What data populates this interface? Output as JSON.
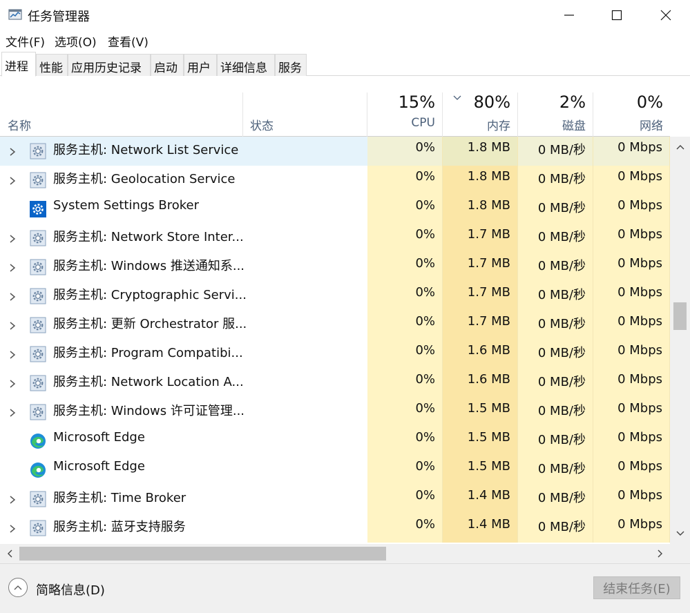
{
  "window": {
    "title": "任务管理器",
    "icon": "task-manager-icon"
  },
  "menu": [
    "文件(F)",
    "选项(O)",
    "查看(V)"
  ],
  "tabs": [
    "进程",
    "性能",
    "应用历史记录",
    "启动",
    "用户",
    "详细信息",
    "服务"
  ],
  "active_tab": "进程",
  "columns": {
    "name": "名称",
    "status": "状态",
    "cpu": {
      "percent": "15%",
      "label": "CPU"
    },
    "memory": {
      "percent": "80%",
      "label": "内存"
    },
    "disk": {
      "percent": "2%",
      "label": "磁盘"
    },
    "network": {
      "percent": "0%",
      "label": "网络"
    }
  },
  "processes": [
    {
      "name": "服务主机: Network List Service",
      "icon": "gear-icon",
      "expandable": true,
      "selected": true,
      "cpu": "0%",
      "mem": "1.8 MB",
      "disk": "0 MB/秒",
      "net": "0 Mbps"
    },
    {
      "name": "服务主机: Geolocation Service",
      "icon": "gear-icon",
      "expandable": true,
      "cpu": "0%",
      "mem": "1.8 MB",
      "disk": "0 MB/秒",
      "net": "0 Mbps"
    },
    {
      "name": "System Settings Broker",
      "icon": "settings-blue-icon",
      "expandable": false,
      "cpu": "0%",
      "mem": "1.8 MB",
      "disk": "0 MB/秒",
      "net": "0 Mbps"
    },
    {
      "name": "服务主机: Network Store Inter...",
      "icon": "gear-icon",
      "expandable": true,
      "cpu": "0%",
      "mem": "1.7 MB",
      "disk": "0 MB/秒",
      "net": "0 Mbps"
    },
    {
      "name": "服务主机: Windows 推送通知系...",
      "icon": "gear-icon",
      "expandable": true,
      "cpu": "0%",
      "mem": "1.7 MB",
      "disk": "0 MB/秒",
      "net": "0 Mbps"
    },
    {
      "name": "服务主机: Cryptographic Servi...",
      "icon": "gear-icon",
      "expandable": true,
      "cpu": "0%",
      "mem": "1.7 MB",
      "disk": "0 MB/秒",
      "net": "0 Mbps"
    },
    {
      "name": "服务主机: 更新 Orchestrator 服...",
      "icon": "gear-icon",
      "expandable": true,
      "cpu": "0%",
      "mem": "1.7 MB",
      "disk": "0 MB/秒",
      "net": "0 Mbps"
    },
    {
      "name": "服务主机: Program Compatibi...",
      "icon": "gear-icon",
      "expandable": true,
      "cpu": "0%",
      "mem": "1.6 MB",
      "disk": "0 MB/秒",
      "net": "0 Mbps"
    },
    {
      "name": "服务主机: Network Location A...",
      "icon": "gear-icon",
      "expandable": true,
      "cpu": "0%",
      "mem": "1.6 MB",
      "disk": "0 MB/秒",
      "net": "0 Mbps"
    },
    {
      "name": "服务主机: Windows 许可证管理...",
      "icon": "gear-icon",
      "expandable": true,
      "cpu": "0%",
      "mem": "1.5 MB",
      "disk": "0 MB/秒",
      "net": "0 Mbps"
    },
    {
      "name": "Microsoft Edge",
      "icon": "edge-icon",
      "expandable": false,
      "cpu": "0%",
      "mem": "1.5 MB",
      "disk": "0 MB/秒",
      "net": "0 Mbps"
    },
    {
      "name": "Microsoft Edge",
      "icon": "edge-icon",
      "expandable": false,
      "cpu": "0%",
      "mem": "1.5 MB",
      "disk": "0 MB/秒",
      "net": "0 Mbps"
    },
    {
      "name": "服务主机: Time Broker",
      "icon": "gear-icon",
      "expandable": true,
      "cpu": "0%",
      "mem": "1.4 MB",
      "disk": "0 MB/秒",
      "net": "0 Mbps"
    },
    {
      "name": "服务主机: 蓝牙支持服务",
      "icon": "gear-icon",
      "expandable": true,
      "cpu": "0%",
      "mem": "1.4 MB",
      "disk": "0 MB/秒",
      "net": "0 Mbps"
    }
  ],
  "footer": {
    "fewer_details": "简略信息(D)",
    "end_task": "结束任务(E)"
  },
  "colors": {
    "heat_light": "#fff4c4",
    "heat_medium": "#fbe6a6",
    "selected_row": "#e5f3fb",
    "header_label": "#4c607a"
  }
}
